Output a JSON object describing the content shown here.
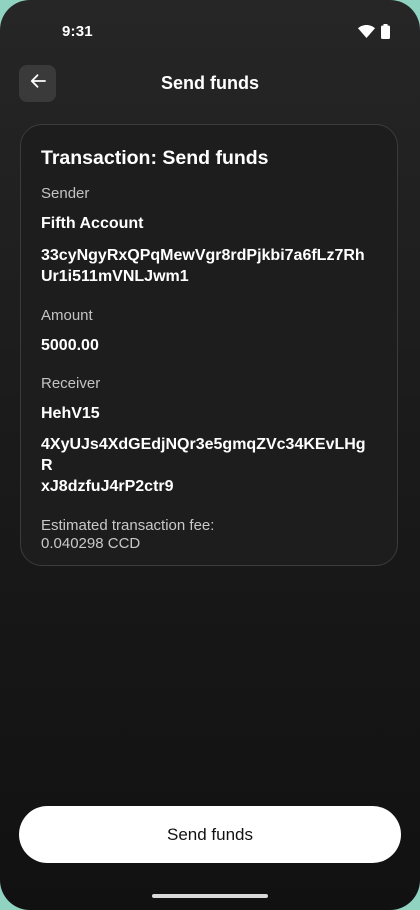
{
  "status_bar": {
    "time": "9:31",
    "icons": [
      "wifi-icon",
      "battery-icon"
    ]
  },
  "header": {
    "title": "Send funds",
    "back_icon": "arrow-left-icon"
  },
  "card": {
    "title": "Transaction: Send funds",
    "sender_label": "Sender",
    "sender_name": "Fifth Account",
    "sender_address_line1": "33cyNgyRxQPqMewVgr8rdPjkbi7a6fLz7Rh",
    "sender_address_line2": "Ur1i511mVNLJwm1",
    "amount_label": "Amount",
    "amount_value": "5000.00",
    "receiver_label": "Receiver",
    "receiver_name": "HehV15",
    "receiver_address_line1": "4XyUJs4XdGEdjNQr3e5gmqZVc34KEvLHgR",
    "receiver_address_line2": "xJ8dzfuJ4rP2ctr9",
    "fee_label": "Estimated transaction fee:",
    "fee_value": "0.040298 CCD"
  },
  "footer": {
    "send_button_label": "Send funds"
  },
  "colors": {
    "background": "#1b1b1b",
    "card_border": "#3b3b3b",
    "button_bg": "#ffffff",
    "outer_accent": "#8fd3c0"
  }
}
